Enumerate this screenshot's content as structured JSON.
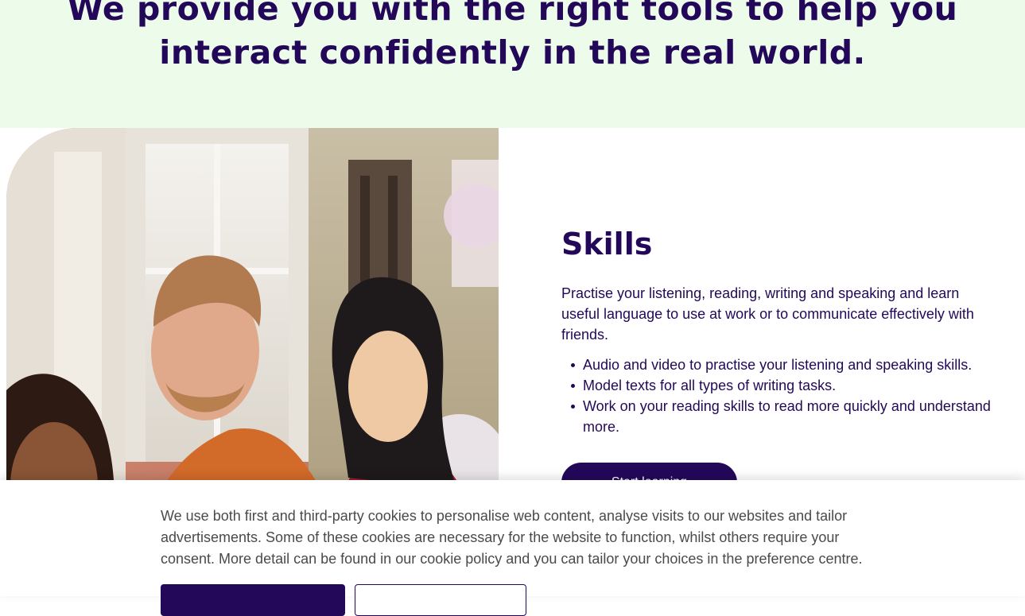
{
  "hero": {
    "heading_line1": "We provide you with the right tools to help you",
    "heading_line2": "interact confidently in the real world."
  },
  "skills": {
    "title": "Skills",
    "description": "Practise your listening, reading, writing and speaking and learn useful language to use at work or to communicate effectively with friends.",
    "bullets": [
      "Audio and video to practise your listening and speaking skills.",
      "Model texts for all types of writing tasks.",
      "Work on your reading skills to read more quickly and understand more."
    ],
    "cta_label": "Start learning"
  },
  "cookie_banner": {
    "text_before_link": "We use both first and third-party cookies to personalise web content, analyse visits to our websites and tailor advertisements. Some of these cookies are necessary for the website to function, whilst others require your consent. More detail can be found in our ",
    "link_text": "cookie policy",
    "text_after_link": " and you can tailor your choices in the preference centre."
  },
  "colors": {
    "brand": "#23085a",
    "hero_background": "#edfbea",
    "banner_text": "#4a4a4a"
  }
}
